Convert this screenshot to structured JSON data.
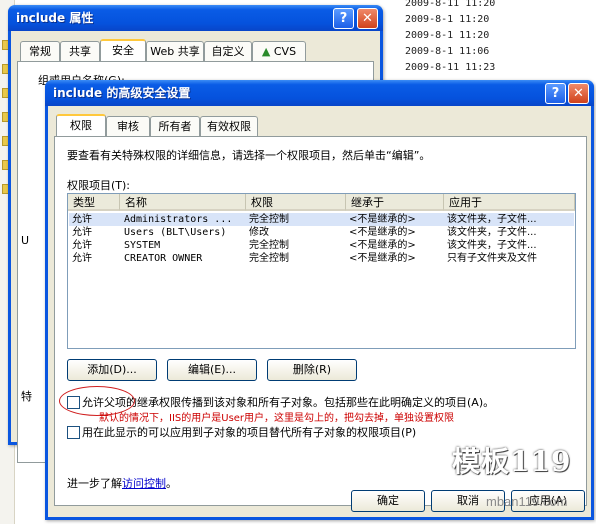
{
  "background": {
    "dates": [
      "2009-8-11 11:20",
      "2009-8-1 11:20",
      "2009-8-1 11:20",
      "2009-8-1 11:06",
      "2009-8-11 11:23"
    ]
  },
  "props_window": {
    "title": "include 属性",
    "help": "?",
    "close": "✕",
    "tabs": [
      "常规",
      "共享",
      "安全",
      "Web 共享",
      "自定义",
      "CVS"
    ],
    "group_label": "组或用户名称(G):",
    "partial_label": "U",
    "partial_label2": "特"
  },
  "adv_window": {
    "title": "include 的高级安全设置",
    "help": "?",
    "close": "✕",
    "tabs": [
      "权限",
      "审核",
      "所有者",
      "有效权限"
    ],
    "intro": "要查看有关特殊权限的详细信息，请选择一个权限项目，然后单击“编辑”。",
    "entries_label": "权限项目(T):",
    "columns": [
      "类型",
      "名称",
      "权限",
      "继承于",
      "应用于"
    ],
    "rows": [
      {
        "type": "允许",
        "name": "Administrators ...",
        "perm": "完全控制",
        "inherit": "<不是继承的>",
        "apply": "该文件夹，子文件..."
      },
      {
        "type": "允许",
        "name": "Users (BLT\\Users)",
        "perm": "修改",
        "inherit": "<不是继承的>",
        "apply": "该文件夹，子文件..."
      },
      {
        "type": "允许",
        "name": "SYSTEM",
        "perm": "完全控制",
        "inherit": "<不是继承的>",
        "apply": "该文件夹，子文件..."
      },
      {
        "type": "允许",
        "name": "CREATOR OWNER",
        "perm": "完全控制",
        "inherit": "<不是继承的>",
        "apply": "只有子文件夹及文件"
      }
    ],
    "add": "添加(D)...",
    "edit": "编辑(E)...",
    "remove": "删除(R)",
    "inherit_checkbox": "允许父项的继承权限传播到该对象和所有子对象。包括那些在此明确定义的项目(A)。",
    "annotation": "默认的情况下，IIS的用户是User用户，这里是勾上的，把勾去掉，单独设置权限",
    "replace_checkbox": "用在此显示的可以应用到子对象的项目替代所有子对象的权限项目(P)",
    "learn_prefix": "进一步了解",
    "learn_link": "访问控制",
    "learn_suffix": "。",
    "ok": "确定",
    "cancel": "取消",
    "apply": "应用(A)"
  },
  "watermark": {
    "logo": "模板119",
    "url": "mban119.com"
  },
  "colors": {
    "annotation": "#cc0000",
    "link": "#0000cc",
    "title_bar": "#0a56e0"
  }
}
